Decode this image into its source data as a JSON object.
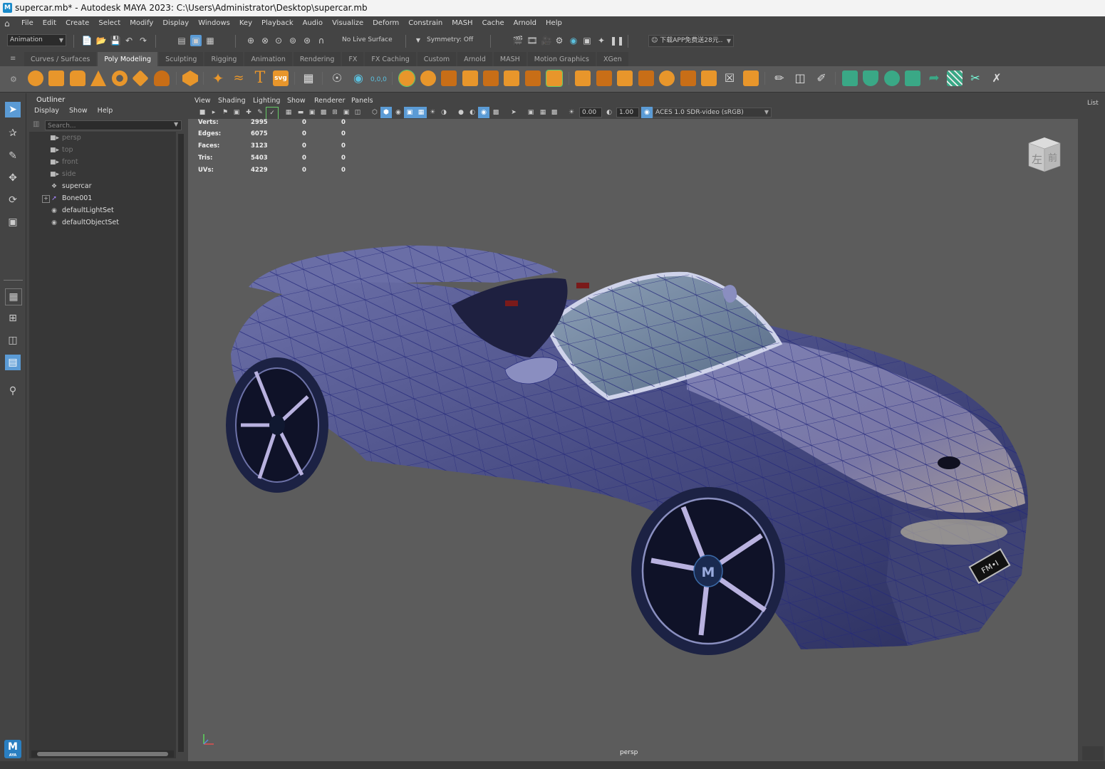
{
  "window": {
    "title": "supercar.mb* - Autodesk MAYA 2023: C:\\Users\\Administrator\\Desktop\\supercar.mb",
    "app_icon_letter": "M"
  },
  "menubar": [
    "File",
    "Edit",
    "Create",
    "Select",
    "Modify",
    "Display",
    "Windows",
    "Key",
    "Playback",
    "Audio",
    "Visualize",
    "Deform",
    "Constrain",
    "MASH",
    "Cache",
    "Arnold",
    "Help"
  ],
  "statusline": {
    "menuset": "Animation",
    "live_surface": "No Live Surface",
    "symmetry": "Symmetry: Off",
    "account": "下载APP免费送28元.."
  },
  "shelf_tabs": [
    "Curves / Surfaces",
    "Poly Modeling",
    "Sculpting",
    "Rigging",
    "Animation",
    "Rendering",
    "FX",
    "FX Caching",
    "Custom",
    "Arnold",
    "MASH",
    "Motion Graphics",
    "XGen"
  ],
  "active_shelf_tab": "Poly Modeling",
  "shelf_text_icons": {
    "text": "T",
    "svg": "svg",
    "snap_value": "0,0,0"
  },
  "outliner": {
    "title": "Outliner",
    "menus": [
      "Display",
      "Show",
      "Help"
    ],
    "search_placeholder": "Search...",
    "items": [
      {
        "label": "persp",
        "icon": "camera-icon",
        "dim": true
      },
      {
        "label": "top",
        "icon": "camera-icon",
        "dim": true
      },
      {
        "label": "front",
        "icon": "camera-icon",
        "dim": true
      },
      {
        "label": "side",
        "icon": "camera-icon",
        "dim": true
      },
      {
        "label": "supercar",
        "icon": "mesh-icon",
        "dim": false
      },
      {
        "label": "Bone001",
        "icon": "joint-icon",
        "dim": false,
        "expandable": true
      },
      {
        "label": "defaultLightSet",
        "icon": "set-icon",
        "dim": false
      },
      {
        "label": "defaultObjectSet",
        "icon": "set-icon",
        "dim": false
      }
    ]
  },
  "viewport": {
    "menus": [
      "View",
      "Shading",
      "Lighting",
      "Show",
      "Renderer",
      "Panels"
    ],
    "exposure": "0.00",
    "gamma": "1.00",
    "color_space": "ACES 1.0 SDR-video (sRGB)",
    "camera_label": "persp",
    "viewcube_labels": [
      "左",
      "前"
    ],
    "hud": [
      {
        "label": "Verts:",
        "a": "2995",
        "b": "0",
        "c": "0"
      },
      {
        "label": "Edges:",
        "a": "6075",
        "b": "0",
        "c": "0"
      },
      {
        "label": "Faces:",
        "a": "3123",
        "b": "0",
        "c": "0"
      },
      {
        "label": "Tris:",
        "a": "5403",
        "b": "0",
        "c": "0"
      },
      {
        "label": "UVs:",
        "a": "4229",
        "b": "0",
        "c": "0"
      }
    ],
    "wheel_badge": "M",
    "plate_text": "FM•I"
  },
  "right_panel": {
    "label": "List"
  },
  "maya_badge": {
    "letter": "M",
    "sub": "AYA"
  },
  "colors": {
    "accent": "#5b9bd5",
    "shelf_orange": "#e8962b",
    "shelf_green": "#3aa886",
    "car_body": "#4a4e86"
  }
}
